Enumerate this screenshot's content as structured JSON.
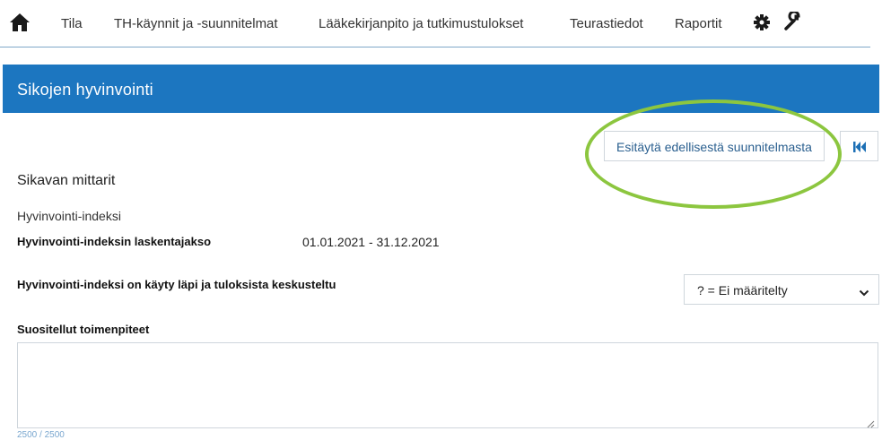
{
  "nav": {
    "items": [
      {
        "label": "Tila"
      },
      {
        "label": "TH-käynnit ja -suunnitelmat"
      },
      {
        "label": "Lääkekirjanpito ja tutkimustulokset"
      },
      {
        "label": "Teurastiedot"
      },
      {
        "label": "Raportit"
      }
    ],
    "icons": {
      "home": "home-icon",
      "settings": "gear-icon",
      "tools": "wrench-icon"
    }
  },
  "banner": {
    "title": "Sikojen hyvinvointi",
    "color": "#1c76c0"
  },
  "actions": {
    "prefill_label": "Esitäytä edellisestä suunnitelmasta",
    "first_icon": "skip-to-first-icon",
    "highlight_color": "#8cc63f"
  },
  "section": {
    "title": "Sikavan mittarit",
    "subtitle": "Hyvinvointi-indeksi",
    "period_label": "Hyvinvointi-indeksin laskentajakso",
    "period_value": "01.01.2021 - 31.12.2021",
    "discussed_label": "Hyvinvointi-indeksi on käyty läpi ja tuloksista keskusteltu",
    "discussed_value": "? = Ei määritelty",
    "recommended_label": "Suositellut toimenpiteet",
    "recommended_value": "",
    "char_counter": "2500 / 2500"
  }
}
